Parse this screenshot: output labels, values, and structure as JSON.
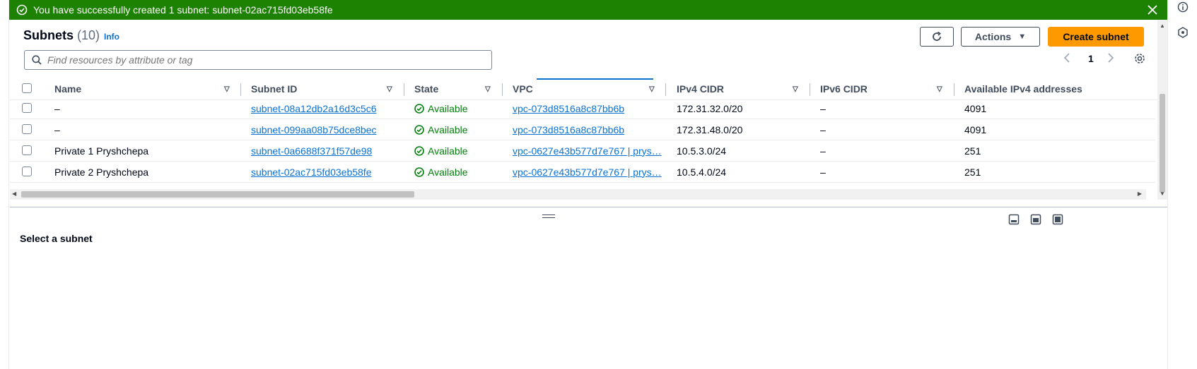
{
  "banner": {
    "message": "You have successfully created 1 subnet: subnet-02ac715fd03eb58fe",
    "status_color": "#1d8102",
    "icons": [
      "check-circle-icon",
      "close-icon"
    ]
  },
  "header": {
    "title": "Subnets",
    "count": "(10)",
    "info_label": "Info",
    "actions_label": "Actions",
    "create_label": "Create subnet"
  },
  "search": {
    "placeholder": "Find resources by attribute or tag"
  },
  "pagination": {
    "current_page": "1"
  },
  "columns": {
    "name": "Name",
    "subnet_id": "Subnet ID",
    "state": "State",
    "vpc": "VPC",
    "ipv4_cidr": "IPv4 CIDR",
    "ipv6_cidr": "IPv6 CIDR",
    "available_ipv4": "Available IPv4 addresses"
  },
  "rows": [
    {
      "name": "–",
      "subnet_id": "subnet-08a12db2a16d3c5c6",
      "state": "Available",
      "vpc": "vpc-073d8516a8c87bb6b",
      "ipv4_cidr": "172.31.32.0/20",
      "ipv6_cidr": "–",
      "available_ipv4": "4091"
    },
    {
      "name": "–",
      "subnet_id": "subnet-099aa08b75dce8bec",
      "state": "Available",
      "vpc": "vpc-073d8516a8c87bb6b",
      "ipv4_cidr": "172.31.48.0/20",
      "ipv6_cidr": "–",
      "available_ipv4": "4091"
    },
    {
      "name": "Private 1 Pryshchepa",
      "subnet_id": "subnet-0a6688f371f57de98",
      "state": "Available",
      "vpc": "vpc-0627e43b577d7e767 | prys…",
      "ipv4_cidr": "10.5.3.0/24",
      "ipv6_cidr": "–",
      "available_ipv4": "251"
    },
    {
      "name": "Private 2 Pryshchepa",
      "subnet_id": "subnet-02ac715fd03eb58fe",
      "state": "Available",
      "vpc": "vpc-0627e43b577d7e767 | prys…",
      "ipv4_cidr": "10.5.4.0/24",
      "ipv6_cidr": "–",
      "available_ipv4": "251"
    }
  ],
  "split_panel": {
    "title": "Select a subnet"
  },
  "colors": {
    "accent": "#ff9900",
    "link": "#0972d3",
    "available": "#037f0c"
  }
}
